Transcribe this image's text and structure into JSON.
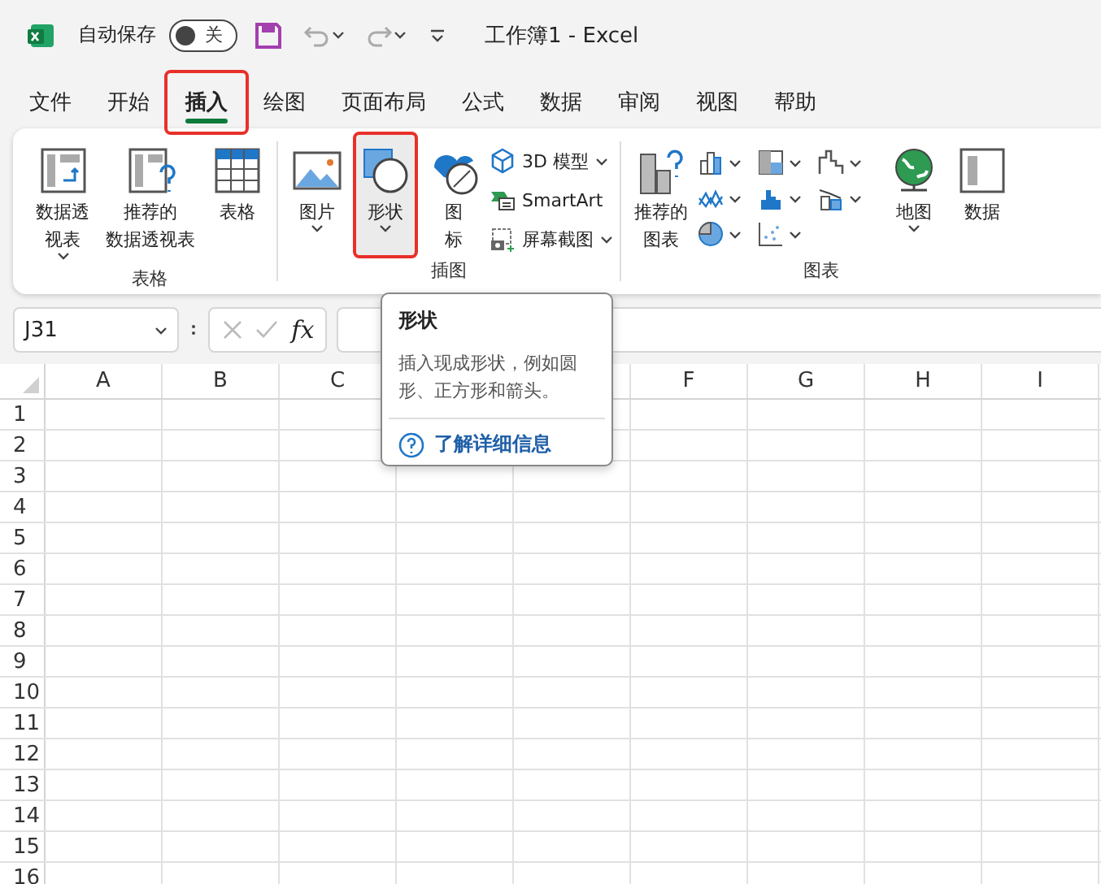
{
  "title_bar": {
    "autosave_label": "自动保存",
    "autosave": {
      "on": false,
      "label": "关"
    },
    "document_title": "工作簿1  -  Excel"
  },
  "tabs": [
    {
      "label": "文件",
      "selected": false,
      "highlighted": false
    },
    {
      "label": "开始",
      "selected": false,
      "highlighted": false
    },
    {
      "label": "插入",
      "selected": true,
      "highlighted": true
    },
    {
      "label": "绘图",
      "selected": false,
      "highlighted": false
    },
    {
      "label": "页面布局",
      "selected": false,
      "highlighted": false
    },
    {
      "label": "公式",
      "selected": false,
      "highlighted": false
    },
    {
      "label": "数据",
      "selected": false,
      "highlighted": false
    },
    {
      "label": "审阅",
      "selected": false,
      "highlighted": false
    },
    {
      "label": "视图",
      "selected": false,
      "highlighted": false
    },
    {
      "label": "帮助",
      "selected": false,
      "highlighted": false
    }
  ],
  "ribbon": {
    "groups": [
      {
        "label": "表格",
        "items": [
          {
            "kind": "large",
            "lines": [
              "数据透",
              "视表"
            ],
            "caret": true,
            "highlighted": false
          },
          {
            "kind": "large",
            "lines": [
              "推荐的",
              "数据透视表"
            ],
            "caret": false,
            "highlighted": false
          },
          {
            "kind": "large",
            "lines": [
              "表格"
            ],
            "caret": false,
            "highlighted": false
          }
        ]
      },
      {
        "label": "插图",
        "items": [
          {
            "kind": "large",
            "lines": [
              "图片"
            ],
            "caret": true,
            "highlighted": false
          },
          {
            "kind": "large",
            "lines": [
              "形状"
            ],
            "caret": true,
            "highlighted": true
          },
          {
            "kind": "large",
            "lines": [
              "图",
              "标"
            ],
            "caret": false,
            "highlighted": false
          },
          {
            "kind": "small",
            "lines": [
              "3D 模型"
            ],
            "caret": true
          },
          {
            "kind": "small",
            "lines": [
              "SmartArt"
            ],
            "caret": false
          },
          {
            "kind": "small",
            "lines": [
              "屏幕截图"
            ],
            "caret": true
          }
        ]
      },
      {
        "label": "图表",
        "items": [
          {
            "kind": "large",
            "lines": [
              "推荐的",
              "图表"
            ],
            "caret": false,
            "highlighted": false
          },
          {
            "kind": "icon",
            "caret": true
          },
          {
            "kind": "icon",
            "caret": true
          },
          {
            "kind": "icon",
            "caret": true
          },
          {
            "kind": "icon",
            "caret": true
          },
          {
            "kind": "icon",
            "caret": true
          },
          {
            "kind": "icon",
            "caret": true
          },
          {
            "kind": "icon",
            "caret": true
          },
          {
            "kind": "icon",
            "caret": true
          },
          {
            "kind": "large",
            "lines": [
              "地图"
            ],
            "caret": true,
            "highlighted": false
          },
          {
            "kind": "large",
            "lines": [
              "数据"
            ],
            "caret": false,
            "highlighted": false
          }
        ]
      }
    ]
  },
  "formula_bar": {
    "name_box": "J31",
    "function_label": "fx"
  },
  "sheet": {
    "columns_left": [
      "A",
      "B",
      "C"
    ],
    "columns_right": [
      "F",
      "G",
      "H",
      "I"
    ],
    "rows": [
      "1",
      "2",
      "3",
      "4",
      "5",
      "6",
      "7",
      "8",
      "9",
      "10",
      "11",
      "12",
      "13",
      "14",
      "15",
      "16"
    ]
  },
  "tooltip": {
    "title": "形状",
    "body": "插入现成形状，例如圆形、正方形和箭头。",
    "link": "了解详细信息"
  }
}
